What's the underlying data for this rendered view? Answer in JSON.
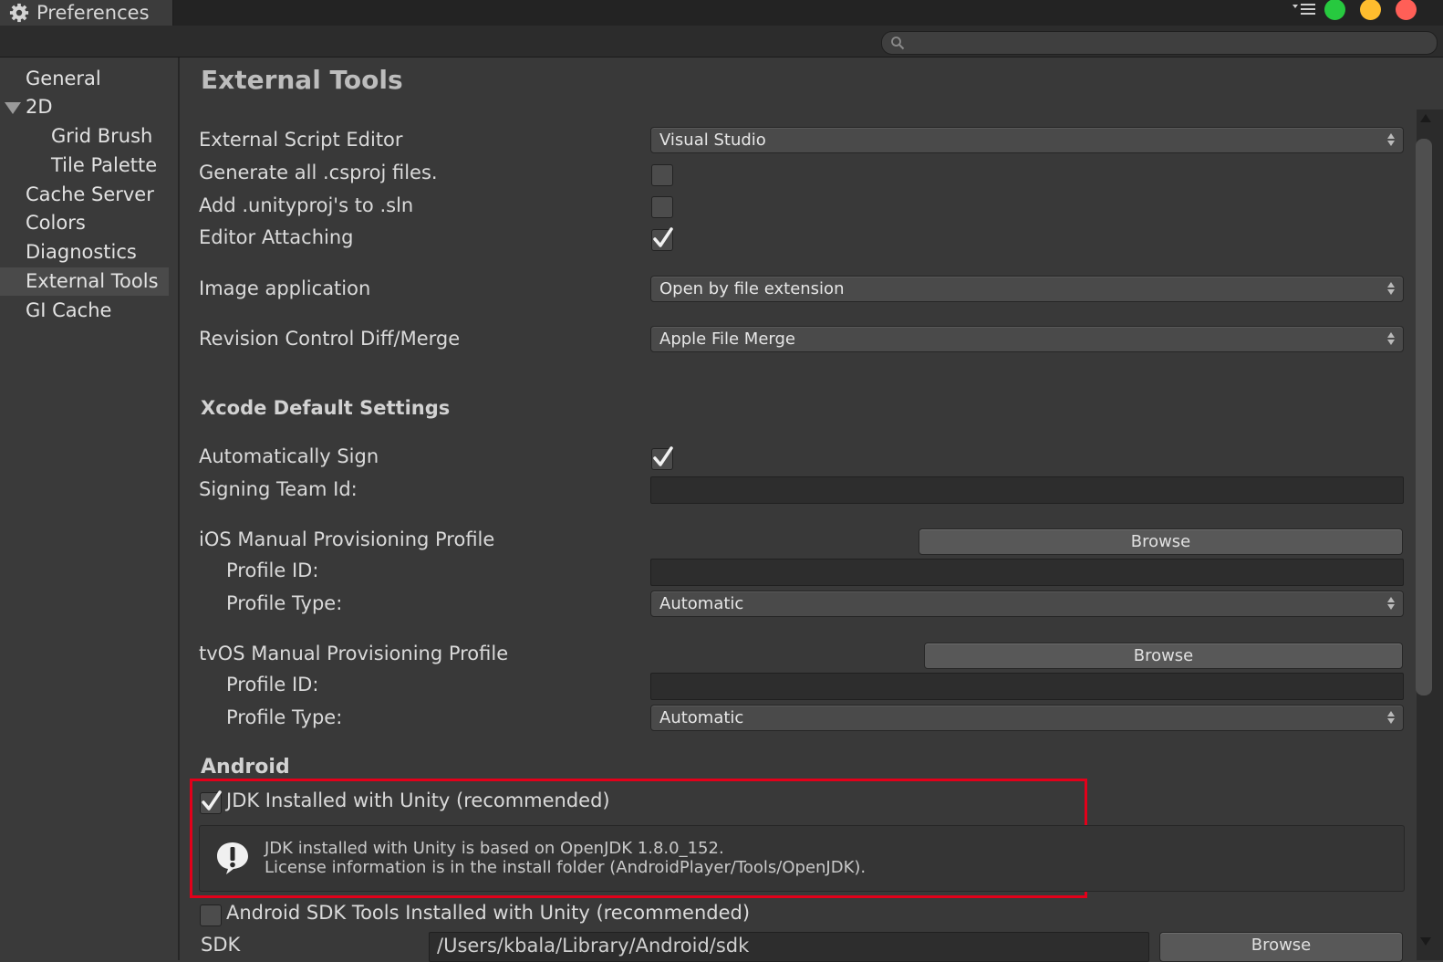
{
  "window": {
    "tab_title": "Preferences",
    "icons": {
      "tab": "gear-icon",
      "menu": "menu-icon",
      "search": "search-icon"
    },
    "traffic_lights": [
      "#27c93f",
      "#ffbd2e",
      "#ff5f57"
    ]
  },
  "search": {
    "placeholder": "",
    "value": ""
  },
  "sidebar": {
    "items": [
      {
        "label": "General"
      },
      {
        "label": "2D"
      },
      {
        "label": "Grid Brush"
      },
      {
        "label": "Tile Palette"
      },
      {
        "label": "Cache Server"
      },
      {
        "label": "Colors"
      },
      {
        "label": "Diagnostics"
      },
      {
        "label": "External Tools"
      },
      {
        "label": "GI Cache"
      }
    ],
    "selected": "External Tools"
  },
  "main": {
    "title": "External Tools",
    "script_editor": {
      "label": "External Script Editor",
      "value": "Visual Studio"
    },
    "generate_csproj": {
      "label": "Generate all .csproj files.",
      "checked": false
    },
    "add_unityproj": {
      "label": "Add .unityproj's to .sln",
      "checked": false
    },
    "editor_attaching": {
      "label": "Editor Attaching",
      "checked": true
    },
    "image_app": {
      "label": "Image application",
      "value": "Open by file extension"
    },
    "revision_diff": {
      "label": "Revision Control Diff/Merge",
      "value": "Apple File Merge"
    },
    "xcode": {
      "header": "Xcode Default Settings",
      "auto_sign": {
        "label": "Automatically Sign",
        "checked": true
      },
      "team_id": {
        "label": "Signing Team Id:",
        "value": ""
      },
      "ios": {
        "label": "iOS Manual Provisioning Profile",
        "browse": "Browse",
        "profile_id_label": "Profile ID:",
        "profile_id": "",
        "profile_type_label": "Profile Type:",
        "profile_type": "Automatic"
      },
      "tvos": {
        "label": "tvOS Manual Provisioning Profile",
        "browse": "Browse",
        "profile_id_label": "Profile ID:",
        "profile_id": "",
        "profile_type_label": "Profile Type:",
        "profile_type": "Automatic"
      }
    },
    "android": {
      "header": "Android",
      "jdk": {
        "label": "JDK Installed with Unity (recommended)",
        "checked": true
      },
      "help": {
        "line1": "JDK installed with Unity is based on OpenJDK 1.8.0_152.",
        "line2": "License information is in the install folder (AndroidPlayer/Tools/OpenJDK)."
      },
      "sdk_tools": {
        "label": "Android SDK Tools Installed with Unity (recommended)",
        "checked": false
      },
      "sdk": {
        "label": "SDK",
        "value": "/Users/kbala/Library/Android/sdk",
        "browse": "Browse"
      }
    }
  },
  "colors": {
    "highlight_box": "#e2001a",
    "background": "#393939"
  }
}
